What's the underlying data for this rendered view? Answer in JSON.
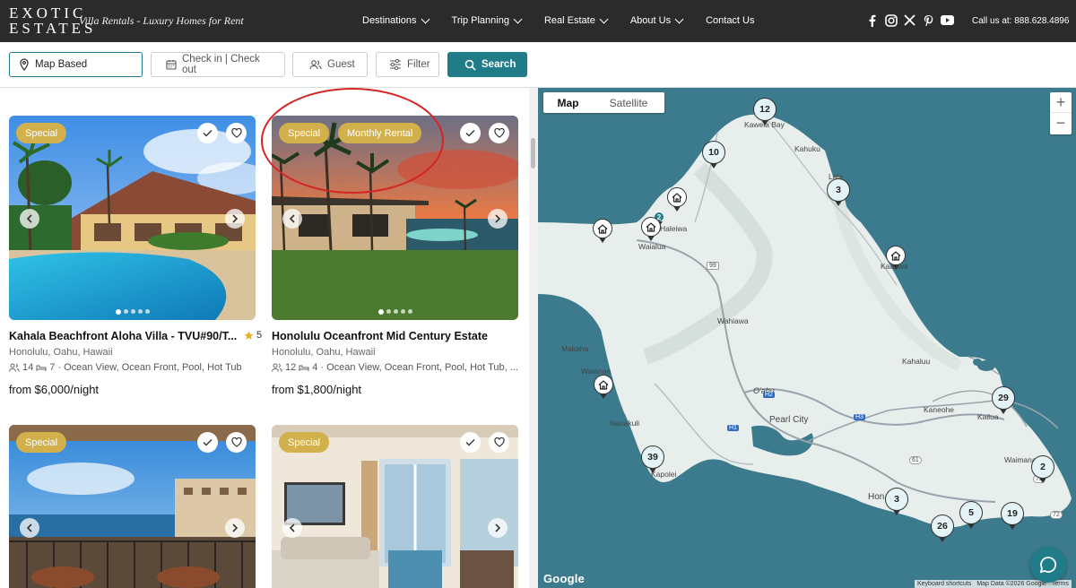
{
  "header": {
    "logo_text": "EXOTIC ESTATES",
    "tagline": "Villa Rentals - Luxury Homes for Rent",
    "nav": [
      {
        "label": "Destinations",
        "dropdown": true
      },
      {
        "label": "Trip Planning",
        "dropdown": true
      },
      {
        "label": "Real Estate",
        "dropdown": true
      },
      {
        "label": "About Us",
        "dropdown": true
      },
      {
        "label": "Contact Us",
        "dropdown": false
      }
    ],
    "social_icons": [
      "facebook-icon",
      "instagram-icon",
      "x-icon",
      "pinterest-icon",
      "youtube-icon"
    ],
    "phone": "Call us at: 888.628.4896"
  },
  "search": {
    "location_value": "Map Based",
    "dates_placeholder": "Check in | Check out",
    "guest_placeholder": "Guest",
    "filter_label": "Filter",
    "search_label": "Search"
  },
  "listings": [
    {
      "badges": [
        "Special"
      ],
      "title": "Kahala Beachfront Aloha Villa - TVU#90/T...",
      "rating": "5",
      "location": "Honolulu, Oahu, Hawaii",
      "guests": "14",
      "bedrooms": "7",
      "features": "· Ocean View, Ocean Front, Pool, Hot Tub",
      "price_prefix": "from",
      "price": "$6,000/night"
    },
    {
      "badges": [
        "Special",
        "Monthly Rental"
      ],
      "title": "Honolulu Oceanfront Mid Century Estate",
      "rating": "",
      "location": "Honolulu, Oahu, Hawaii",
      "guests": "12",
      "bedrooms": "4",
      "features": "· Ocean View, Ocean Front, Pool, Hot Tub, ...",
      "price_prefix": "from",
      "price": "$1,800/night"
    },
    {
      "badges": [
        "Special"
      ]
    },
    {
      "badges": [
        "Special"
      ]
    }
  ],
  "map": {
    "tab_map": "Map",
    "tab_satellite": "Satellite",
    "active_tab": "Map",
    "cluster_counts": [
      "12",
      "10",
      "3",
      "2",
      "29",
      "39",
      "2",
      "3",
      "26",
      "5",
      "19"
    ],
    "place_labels": [
      "Kawela Bay",
      "Kahuku",
      "Laie",
      "Haleiwa",
      "Waialua",
      "Kaaawa",
      "Wahiawa",
      "Makaha",
      "Waianae",
      "O'ahu",
      "Kahaluu",
      "Kaneohe",
      "Kailua",
      "Pearl City",
      "Nanakuli",
      "Kapolei",
      "Waimanalo",
      "Hon"
    ],
    "highway_shields": [
      "99",
      "H2",
      "H1",
      "H3",
      "61",
      "72",
      "72"
    ],
    "google_label": "Google",
    "footer_links": [
      "Keyboard shortcuts",
      "Map Data ©2026 Google",
      "Terms"
    ],
    "zoom_in": "+",
    "zoom_out": "−"
  },
  "colors": {
    "accent": "#1f7c88",
    "badge_gold": "#d2b04c",
    "header_bg": "#2b2b2b",
    "ocean": "#3c7a8d",
    "land": "#e8eeec",
    "annotation_red": "#d72323"
  }
}
